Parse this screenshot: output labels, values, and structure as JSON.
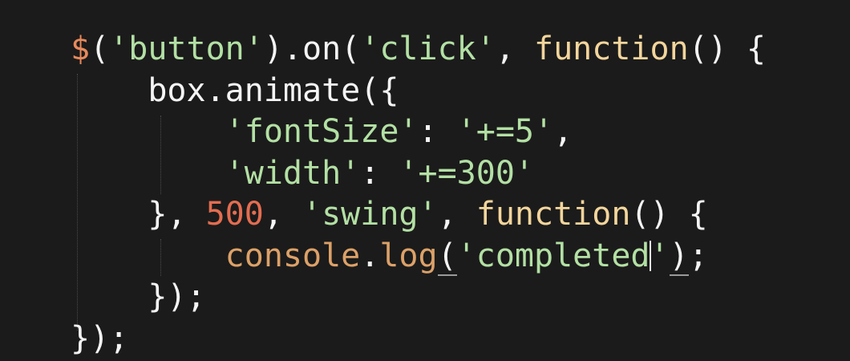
{
  "colors": {
    "background": "#1b1b1b",
    "plain": "#f4f4f4",
    "string": "#b3e0a4",
    "keyword": "#f3d59c",
    "number": "#e36d50",
    "dollar": "#e78a5c",
    "method": "#dca168",
    "guide": "#4a4a4a"
  },
  "code": {
    "lines": [
      {
        "tokens": [
          {
            "t": "$",
            "c": "dollar"
          },
          {
            "t": "(",
            "c": "plain"
          },
          {
            "t": "'button'",
            "c": "string"
          },
          {
            "t": ").on(",
            "c": "plain"
          },
          {
            "t": "'click'",
            "c": "string"
          },
          {
            "t": ", ",
            "c": "plain"
          },
          {
            "t": "function",
            "c": "keyword"
          },
          {
            "t": "() {",
            "c": "plain"
          }
        ]
      },
      {
        "tokens": [
          {
            "t": "    box.animate({",
            "c": "plain"
          }
        ]
      },
      {
        "tokens": [
          {
            "t": "        ",
            "c": "plain"
          },
          {
            "t": "'fontSize'",
            "c": "string"
          },
          {
            "t": ": ",
            "c": "plain"
          },
          {
            "t": "'+=5'",
            "c": "string"
          },
          {
            "t": ",",
            "c": "plain"
          }
        ]
      },
      {
        "tokens": [
          {
            "t": "        ",
            "c": "plain"
          },
          {
            "t": "'width'",
            "c": "string"
          },
          {
            "t": ": ",
            "c": "plain"
          },
          {
            "t": "'+=300'",
            "c": "string"
          }
        ]
      },
      {
        "tokens": [
          {
            "t": "    }, ",
            "c": "plain"
          },
          {
            "t": "500",
            "c": "number"
          },
          {
            "t": ", ",
            "c": "plain"
          },
          {
            "t": "'swing'",
            "c": "string"
          },
          {
            "t": ", ",
            "c": "plain"
          },
          {
            "t": "function",
            "c": "keyword"
          },
          {
            "t": "() {",
            "c": "plain"
          }
        ]
      },
      {
        "tokens": [
          {
            "t": "        ",
            "c": "plain"
          },
          {
            "t": "console",
            "c": "method"
          },
          {
            "t": ".",
            "c": "plain"
          },
          {
            "t": "log",
            "c": "method"
          },
          {
            "t": "(",
            "c": "plain",
            "match": true
          },
          {
            "t": "'completed",
            "c": "string"
          },
          {
            "t": "|",
            "c": "caret"
          },
          {
            "t": "'",
            "c": "string"
          },
          {
            "t": ")",
            "c": "plain",
            "match": true
          },
          {
            "t": ";",
            "c": "plain"
          }
        ]
      },
      {
        "tokens": [
          {
            "t": "    });",
            "c": "plain"
          }
        ]
      },
      {
        "tokens": [
          {
            "t": "});",
            "c": "plain"
          }
        ]
      }
    ]
  }
}
